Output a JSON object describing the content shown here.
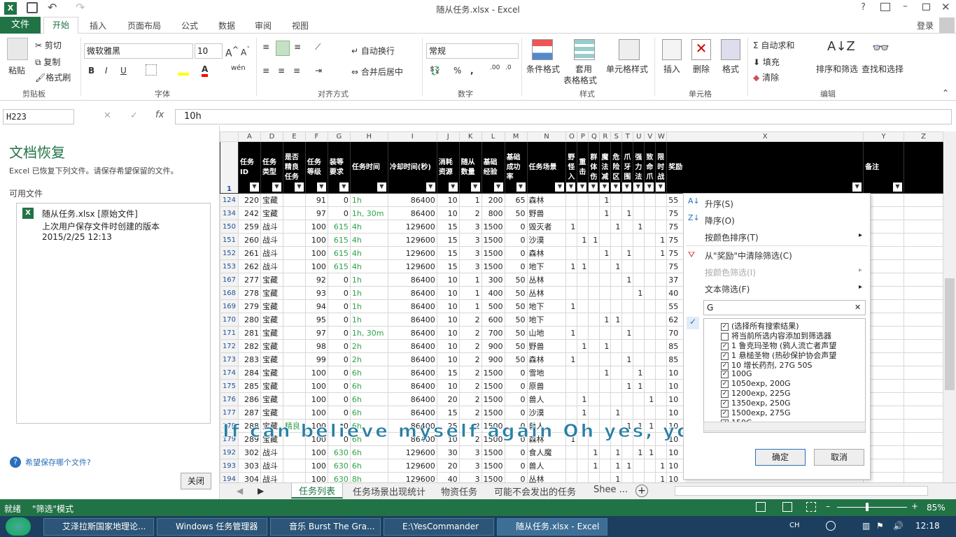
{
  "app": {
    "title": "随从任务.xlsx - Excel",
    "login": "登录"
  },
  "ribbon_tabs": [
    "文件",
    "开始",
    "插入",
    "页面布局",
    "公式",
    "数据",
    "审阅",
    "视图"
  ],
  "ribbon": {
    "paste": "粘贴",
    "cut": "剪切",
    "copy": "复制",
    "format_painter": "格式刷",
    "clipboard": "剪贴板",
    "font_name": "微软雅黑",
    "font_size": "10",
    "font_group": "字体",
    "wrap": "自动换行",
    "merge": "合并后居中",
    "align_group": "对齐方式",
    "number_format": "常规",
    "number_group": "数字",
    "cond_format": "条件格式",
    "table_format": "套用",
    "table_format2": "表格格式",
    "cell_style": "单元格样式",
    "style_group": "样式",
    "insert": "插入",
    "delete": "删除",
    "format": "格式",
    "cells_group": "单元格",
    "autosum": "自动求和",
    "fill": "填充",
    "clear": "清除",
    "sort_filter": "排序和筛选",
    "find_select": "查找和选择",
    "edit_group": "编辑"
  },
  "formula": {
    "name_box": "H223",
    "value": "10h"
  },
  "recovery": {
    "title": "文档恢复",
    "desc": "Excel 已恢复下列文件。请保存希望保留的文件。",
    "available": "可用文件",
    "file_name": "随从任务.xlsx  [原始文件]",
    "file_desc": "上次用户保存文件时创建的版本",
    "file_time": "2015/2/25 12:13",
    "help": "希望保存哪个文件?",
    "close": "关闭"
  },
  "sheet": {
    "col_letters": [
      "A",
      "D",
      "E",
      "F",
      "G",
      "H",
      "I",
      "J",
      "K",
      "L",
      "M",
      "N",
      "O",
      "P",
      "Q",
      "R",
      "S",
      "T",
      "U",
      "V",
      "W",
      "X",
      "Y",
      "Z"
    ],
    "headers": [
      "任务ID",
      "任务类型",
      "是否精良任务",
      "任务等级",
      "装等要求",
      "任务时间",
      "冷却时间(秒)",
      "消耗资源",
      "随从数量",
      "基础经验",
      "基础成功率",
      "任务场景",
      "野怪入",
      "重击",
      "群体伤",
      "魔法减",
      "危险区",
      "爪牙围",
      "强力法",
      "致命爪",
      "限时战",
      "奖励",
      "备注",
      ""
    ],
    "header_row_no": "1",
    "rows": [
      [
        "124",
        "220",
        "宝藏",
        "",
        "91",
        "0",
        "1h",
        "86400",
        "10",
        "1",
        "200",
        "65",
        "森林",
        "",
        "",
        "",
        "1",
        "",
        "",
        "",
        "",
        "",
        "55"
      ],
      [
        "134",
        "242",
        "宝藏",
        "",
        "97",
        "0",
        "1h, 30m",
        "86400",
        "10",
        "2",
        "800",
        "50",
        "野兽",
        "",
        "",
        "",
        "1",
        "",
        "1",
        "",
        "",
        "",
        "75"
      ],
      [
        "150",
        "259",
        "战斗",
        "",
        "100",
        "615",
        "4h",
        "129600",
        "15",
        "3",
        "1500",
        "0",
        "毁灭者",
        "1",
        "",
        "",
        "",
        "1",
        "",
        "1",
        "",
        "",
        "75"
      ],
      [
        "151",
        "260",
        "战斗",
        "",
        "100",
        "615",
        "4h",
        "129600",
        "15",
        "3",
        "1500",
        "0",
        "沙漠",
        "",
        "1",
        "1",
        "",
        "",
        "",
        "",
        "",
        "1",
        "75"
      ],
      [
        "152",
        "261",
        "战斗",
        "",
        "100",
        "615",
        "4h",
        "129600",
        "15",
        "3",
        "1500",
        "0",
        "森林",
        "",
        "",
        "",
        "1",
        "",
        "1",
        "",
        "",
        "1",
        "75"
      ],
      [
        "153",
        "262",
        "战斗",
        "",
        "100",
        "615",
        "4h",
        "129600",
        "15",
        "3",
        "1500",
        "0",
        "地下",
        "1",
        "1",
        "",
        "",
        "1",
        "",
        "",
        "",
        "",
        "75"
      ],
      [
        "167",
        "277",
        "宝藏",
        "",
        "92",
        "0",
        "1h",
        "86400",
        "10",
        "1",
        "300",
        "50",
        "丛林",
        "",
        "",
        "",
        "",
        "",
        "1",
        "",
        "",
        "",
        "37"
      ],
      [
        "168",
        "278",
        "宝藏",
        "",
        "93",
        "0",
        "1h",
        "86400",
        "10",
        "1",
        "400",
        "50",
        "丛林",
        "",
        "",
        "",
        "",
        "",
        "",
        "1",
        "",
        "",
        "40"
      ],
      [
        "169",
        "279",
        "宝藏",
        "",
        "94",
        "0",
        "1h",
        "86400",
        "10",
        "1",
        "500",
        "50",
        "地下",
        "1",
        "",
        "",
        "",
        "",
        "",
        "",
        "",
        "",
        "55"
      ],
      [
        "170",
        "280",
        "宝藏",
        "",
        "95",
        "0",
        "1h",
        "86400",
        "10",
        "2",
        "600",
        "50",
        "地下",
        "",
        "",
        "",
        "1",
        "1",
        "",
        "",
        "",
        "",
        "62"
      ],
      [
        "171",
        "281",
        "宝藏",
        "",
        "97",
        "0",
        "1h, 30m",
        "86400",
        "10",
        "2",
        "700",
        "50",
        "山地",
        "1",
        "",
        "",
        "",
        "",
        "1",
        "",
        "",
        "",
        "70"
      ],
      [
        "172",
        "282",
        "宝藏",
        "",
        "98",
        "0",
        "2h",
        "86400",
        "10",
        "2",
        "900",
        "50",
        "野兽",
        "",
        "1",
        "",
        "1",
        "",
        "",
        "",
        "",
        "",
        "85"
      ],
      [
        "173",
        "283",
        "宝藏",
        "",
        "99",
        "0",
        "2h",
        "86400",
        "10",
        "2",
        "900",
        "50",
        "森林",
        "1",
        "",
        "",
        "",
        "",
        "1",
        "",
        "",
        "",
        "85"
      ],
      [
        "174",
        "284",
        "宝藏",
        "",
        "100",
        "0",
        "6h",
        "86400",
        "15",
        "2",
        "1500",
        "0",
        "雪地",
        "",
        "",
        "",
        "1",
        "",
        "",
        "1",
        "",
        "",
        "10"
      ],
      [
        "175",
        "285",
        "宝藏",
        "",
        "100",
        "0",
        "6h",
        "86400",
        "10",
        "2",
        "1500",
        "0",
        "原兽",
        "",
        "",
        "",
        "",
        "",
        "1",
        "1",
        "",
        "",
        "10"
      ],
      [
        "176",
        "286",
        "宝藏",
        "",
        "100",
        "0",
        "6h",
        "86400",
        "20",
        "2",
        "1500",
        "0",
        "兽人",
        "",
        "1",
        "",
        "",
        "",
        "",
        "",
        "1",
        "",
        "10"
      ],
      [
        "177",
        "287",
        "宝藏",
        "",
        "100",
        "0",
        "6h",
        "86400",
        "15",
        "2",
        "1500",
        "0",
        "沙漠",
        "",
        "1",
        "",
        "",
        "1",
        "",
        "",
        "",
        "",
        "10"
      ],
      [
        "178",
        "288",
        "宝藏",
        "精良",
        "100",
        "0",
        "6h",
        "86400",
        "25",
        "2",
        "1500",
        "0",
        "兽人",
        "",
        "",
        "",
        "",
        "",
        "1",
        "1",
        "1",
        "",
        "10"
      ],
      [
        "179",
        "289",
        "宝藏",
        "",
        "100",
        "0",
        "6h",
        "86400",
        "10",
        "2",
        "1500",
        "0",
        "森林",
        "1",
        "",
        "",
        "",
        "",
        "",
        "",
        "",
        "",
        "10"
      ],
      [
        "192",
        "302",
        "战斗",
        "",
        "100",
        "630",
        "6h",
        "129600",
        "30",
        "3",
        "1500",
        "0",
        "食人魔",
        "",
        "",
        "1",
        "",
        "1",
        "",
        "1",
        "1",
        "",
        "10"
      ],
      [
        "193",
        "303",
        "战斗",
        "",
        "100",
        "630",
        "6h",
        "129600",
        "20",
        "3",
        "1500",
        "0",
        "兽人",
        "",
        "",
        "1",
        "",
        "1",
        "1",
        "",
        "",
        "1",
        "10"
      ],
      [
        "194",
        "304",
        "战斗",
        "",
        "100",
        "630",
        "8h",
        "129600",
        "40",
        "3",
        "1500",
        "0",
        "丛林",
        "",
        "",
        "",
        "",
        "1",
        "",
        "",
        "",
        "1",
        "10"
      ]
    ]
  },
  "filter_menu": {
    "asc": "升序(S)",
    "desc": "降序(O)",
    "by_color": "按颜色排序(T)",
    "clear": "从\"奖励\"中清除筛选(C)",
    "filter_color": "按颜色筛选(I)",
    "text_filter": "文本筛选(F)",
    "search": "G",
    "items": [
      {
        "label": "(选择所有搜索结果)",
        "checked": true
      },
      {
        "label": "将当前所选内容添加到筛选器",
        "checked": false
      },
      {
        "label": "1 鲁克玛圣物 (鸦人流亡者声望",
        "checked": true
      },
      {
        "label": "1 悬槌圣物 (热砂保护协会声望",
        "checked": true
      },
      {
        "label": "10 增长药剂, 27G 50S",
        "checked": true
      },
      {
        "label": "100G",
        "checked": true
      },
      {
        "label": "1050exp, 200G",
        "checked": true
      },
      {
        "label": "1200exp, 225G",
        "checked": true
      },
      {
        "label": "1350exp, 250G",
        "checked": true
      },
      {
        "label": "1500exp, 275G",
        "checked": true
      },
      {
        "label": "150G",
        "checked": true
      }
    ],
    "ok": "确定",
    "cancel": "取消"
  },
  "sheet_tabs": [
    "任务列表",
    "任务场景出现统计",
    "物资任务",
    "可能不会发出的任务",
    "Shee ..."
  ],
  "status": {
    "ready": "就绪",
    "mode": "\"筛选\"模式",
    "zoom": "85%"
  },
  "subtitle": "If can believe myself again Oh yes, yo",
  "taskbar": {
    "items": [
      "艾泽拉斯国家地理论...",
      "Windows 任务管理器",
      "音乐 Burst The Gra...",
      "E:\\YesCommander",
      "随从任务.xlsx - Excel"
    ],
    "lang": "CH",
    "time": "12:18"
  }
}
